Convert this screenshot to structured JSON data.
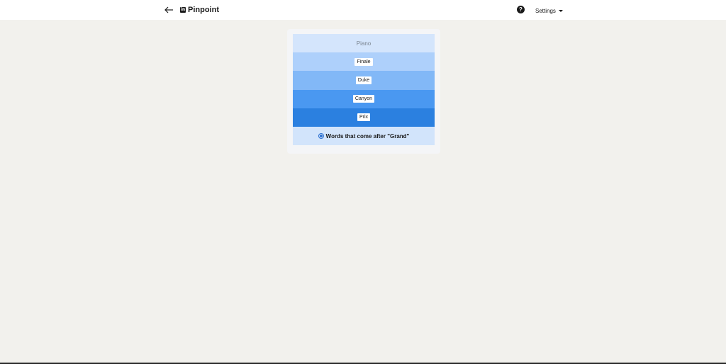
{
  "header": {
    "brand": "Pinpoint",
    "settings_label": "Settings"
  },
  "game": {
    "clues": [
      {
        "text": "Piano",
        "revealed": false
      },
      {
        "text": "Finale",
        "revealed": true
      },
      {
        "text": "Duke",
        "revealed": true
      },
      {
        "text": "Canyon",
        "revealed": true
      },
      {
        "text": "Prix",
        "revealed": true
      }
    ],
    "answer": "Words that come after \"Grand\""
  },
  "colors": {
    "background": "#f2f1ed",
    "row_shades": [
      "#d4e5fc",
      "#aed0fb",
      "#82b8f7",
      "#4a98f1",
      "#2b80e0"
    ],
    "accent": "#2b6fd0"
  },
  "icons": {
    "back": "arrow-left-icon",
    "logo": "linkedin-logo-icon",
    "help": "question-circle-icon",
    "settings_caret": "caret-down-icon",
    "answer": "check-circle-icon"
  }
}
